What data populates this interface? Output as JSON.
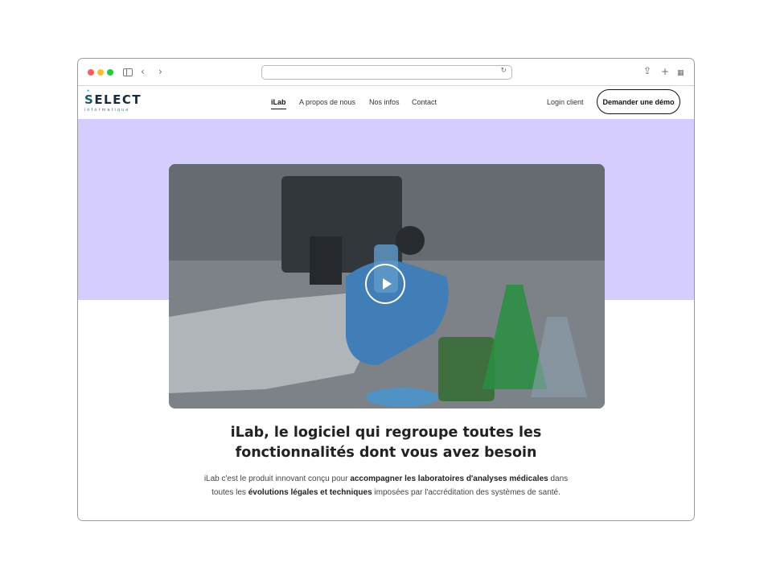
{
  "browser": {
    "url_text": "",
    "icons": [
      "sidebar-icon",
      "back-arrow-icon",
      "forward-arrow-icon",
      "reload-icon",
      "share-icon",
      "new-tab-icon",
      "tab-overview-icon"
    ]
  },
  "header": {
    "logo_word": "ELECT",
    "logo_letter": "S",
    "logo_sub": "informatique",
    "nav": [
      {
        "label": "iLab"
      },
      {
        "label": "A propos de nous"
      },
      {
        "label": "Nos infos"
      },
      {
        "label": "Contact"
      }
    ],
    "login_label": "Login client",
    "demo_label": "Demander une démo"
  },
  "hero": {
    "title_line1": "iLab, le logiciel qui regroupe toutes les",
    "title_line2": "fonctionnalités dont vous avez besoin",
    "desc": {
      "p1": "iLab c'est le produit innovant conçu pour ",
      "b1": "accompagner les laboratoires d'analyses médicales",
      "p2": " dans toutes les ",
      "b2": "évolutions légales et techniques",
      "p3": " imposées par l'accréditation des systèmes de santé."
    }
  },
  "colors": {
    "hero_bg": "#d4cdfd",
    "glove": "#4a8fd0",
    "flask_green": "#2fa34a"
  }
}
